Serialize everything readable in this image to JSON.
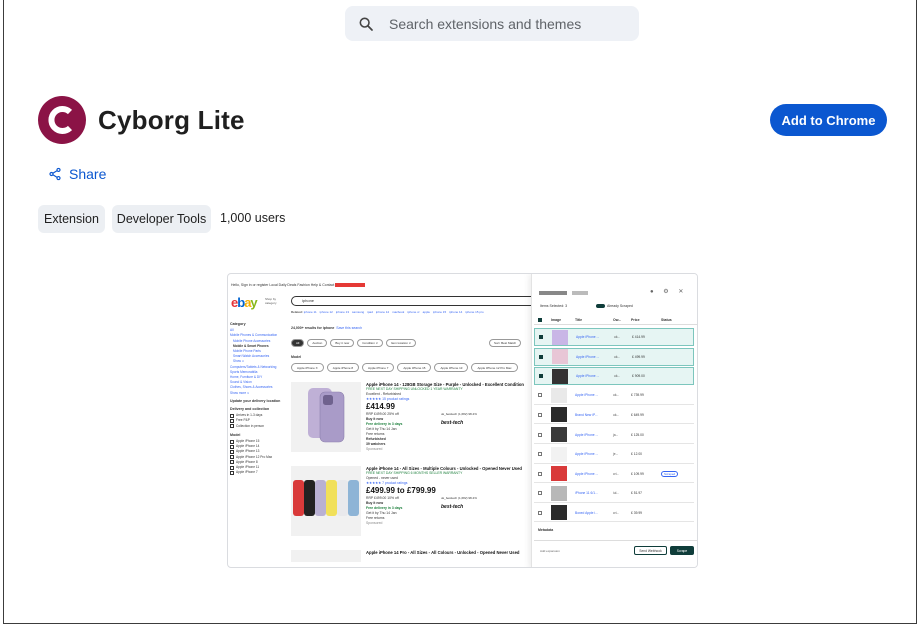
{
  "search": {
    "placeholder": "Search extensions and themes"
  },
  "extension": {
    "name": "Cyborg Lite",
    "brand_color": "#8b1346"
  },
  "actions": {
    "add_to_chrome": "Add to Chrome",
    "share": "Share"
  },
  "chips": [
    "Extension",
    "Developer Tools"
  ],
  "users": "1,000 users",
  "screenshot": {
    "topnav": "Hello, Sign in or register  Local  Daily Deals  Fashion  Help & Contact",
    "topnav_promo": "",
    "ebay_logo": "ebay",
    "shop_by": "Shop by category",
    "search_query": "iphone",
    "related": [
      "iphone 11",
      "iphone 12",
      "iphone 13",
      "samsung",
      "ipad",
      "iphone 14",
      "macbook",
      "iphone xr",
      "apple",
      "iphone 15",
      "iphone 14",
      "iphone 15 pro"
    ],
    "related_label": "Related:",
    "category_heading": "Category",
    "categories": [
      "All",
      "Mobile Phones & Communication",
      "Mobile Phone Accessories",
      "Mobile & Smart Phones",
      "Mobile Phone Parts",
      "Smart Watch Accessories",
      "Show ∨",
      "Computers/Tablets & Networking",
      "Sports Memorabilia",
      "Home, Furniture & DIY",
      "Sound & Vision",
      "Clothes, Shoes & Accessories",
      "Show more ∨"
    ],
    "update_delivery": "Update your delivery location",
    "delivery_heading": "Delivery and collection",
    "delivery_options": [
      "Arrives in 1-3 days",
      "Free P&P",
      "Collection in person"
    ],
    "model_heading": "Model",
    "model_options": [
      "Apple iPhone 15",
      "Apple iPhone 14",
      "Apple iPhone 13",
      "Apple iPhone 12 Pro Max",
      "Apple iPhone 8",
      "Apple iPhone 11",
      "Apple iPhone 7"
    ],
    "results": "24,000+ results for iphone",
    "save_search": "Save this search",
    "filters": [
      "All",
      "Auction",
      "Buy it now",
      "Condition ∨",
      "Item location ∨"
    ],
    "sort": "Sort: Best Match",
    "models_row_heading": "Model",
    "models_row": [
      "Apple iPhone X",
      "Apple iPhone 8",
      "Apple iPhone 7",
      "Apple iPhone 15",
      "Apple iPhone 13",
      "Apple iPhone 12 Pro Max"
    ],
    "items": [
      {
        "name": "Apple iPhone 14 - 128GB Storage Size - Purple - Unlocked - Excellent Condition",
        "badges": "FREE NEXT DAY SHIPPING  UNLOCKED  1 YEAR WARRANTY",
        "condition": "Excellent - Refurbished",
        "ratings": "★★★★★ 15 product ratings",
        "price": "£414.99",
        "rrp": "RRP £499.00  25% off",
        "buy": "Buy it now",
        "delivery": "Free delivery in 3 days",
        "get_it": "Get it by Thu 14 Jan",
        "returns": "Free returns",
        "refurb": "Refurbished",
        "watchers": "39 watchers",
        "seller": "uk_besttech (1,682) 98.4%",
        "seller_brand": "best-tech",
        "sponsored": "Sponsored"
      },
      {
        "name": "Apple iPhone 14 - All Sizes - Multiple Colours - Unlocked - Opened Never Used",
        "badges": "FREE NEXT DAY SHIPPING  6 MONTHS SELLER WARRANTY",
        "condition": "Opened - never used",
        "ratings": "★★★★★ 7 product ratings",
        "price": "£499.99 to £799.99",
        "rrp": "RRP £499.00  10% off",
        "buy": "Buy it now",
        "delivery": "Free delivery in 3 days",
        "get_it": "Get it by Thu 14 Jan",
        "returns": "Free returns",
        "refurb": "",
        "watchers": "",
        "seller": "uk_besttech (1,682) 98.4%",
        "seller_brand": "best-tech",
        "sponsored": "Sponsored"
      },
      {
        "name": "Apple iPhone 14 Pro - All Sizes - All Colours - Unlocked - Opened Never Used",
        "badges": "",
        "condition": "",
        "ratings": "",
        "price": "",
        "rrp": "",
        "buy": "",
        "delivery": "",
        "get_it": "",
        "returns": "",
        "refurb": "",
        "watchers": "",
        "seller": "",
        "seller_brand": "",
        "sponsored": ""
      }
    ],
    "panel": {
      "items_selected": "Items Selected: 3",
      "already_scraped": "Already Scraped",
      "columns": [
        "Image",
        "Title",
        "Ow...",
        "Price",
        "Status"
      ],
      "rows": [
        {
          "title": "Apple iPhone ...",
          "owner": "uk...",
          "price": "£ 414.99",
          "status": "",
          "selected": true,
          "highlight": true
        },
        {
          "title": "Apple iPhone ...",
          "owner": "uk...",
          "price": "£ 499.99",
          "status": "",
          "selected": true,
          "highlight": true
        },
        {
          "title": "Apple iPhone ...",
          "owner": "uk...",
          "price": "£ 909.00",
          "status": "",
          "selected": true,
          "highlight": true
        },
        {
          "title": "Apple iPhone ...",
          "owner": "uk...",
          "price": "£ 739.99",
          "status": "",
          "selected": false,
          "highlight": false
        },
        {
          "title": "Brand New iP...",
          "owner": "uk...",
          "price": "£ 649.99",
          "status": "",
          "selected": false,
          "highlight": false
        },
        {
          "title": "Apple iPhone ...",
          "owner": "ja...",
          "price": "£ 125.00",
          "status": "",
          "selected": false,
          "highlight": false
        },
        {
          "title": "Apple iPhone ...",
          "owner": "je...",
          "price": "£ 12.00",
          "status": "",
          "selected": false,
          "highlight": false
        },
        {
          "title": "Apple iPhone ...",
          "owner": "cri...",
          "price": "£ 109.99",
          "status": "Scraped",
          "selected": false,
          "highlight": false
        },
        {
          "title": "iPhone 11 6/1...",
          "owner": "iul...",
          "price": "£ 51.97",
          "status": "",
          "selected": false,
          "highlight": false
        },
        {
          "title": "Boxed Apple i...",
          "owner": "cri...",
          "price": "£ 39.99",
          "status": "",
          "selected": false,
          "highlight": false
        }
      ],
      "metadata": "Metadata",
      "add_expansion": "Add expansion",
      "count": "3",
      "send": "Send Webhook",
      "scrape": "Scrape",
      "accent": "#0f3d3a"
    }
  }
}
